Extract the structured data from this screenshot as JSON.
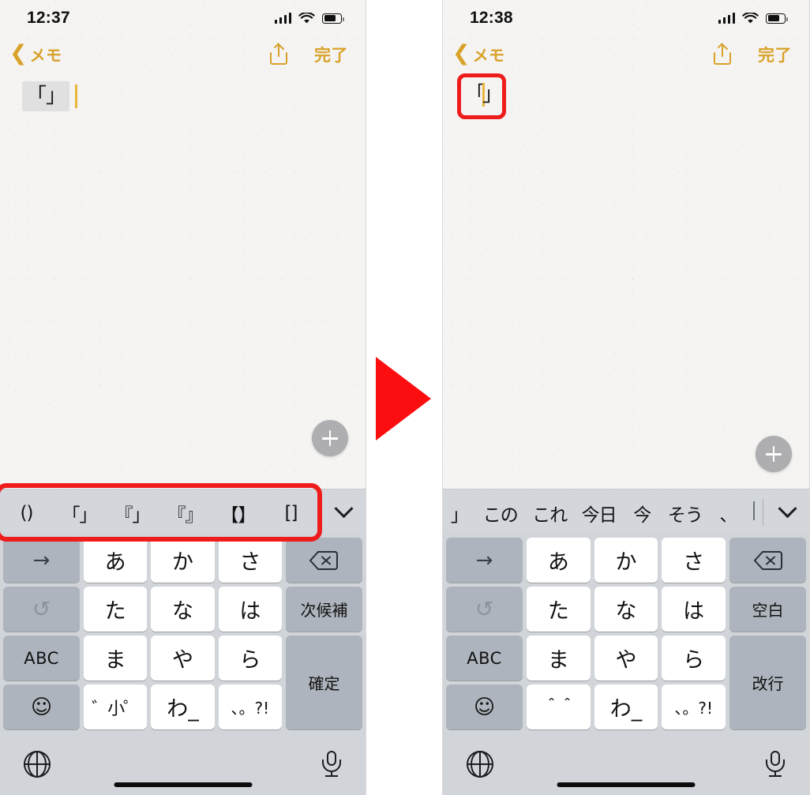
{
  "meta": {
    "accent_gold": "#d8a22a",
    "annotation_red": "#ef1c1c",
    "caret_color": "#e8b63c"
  },
  "panels": [
    {
      "id": "before",
      "status": {
        "time": "12:37",
        "signal_icon": "cellular-bars-icon",
        "wifi_icon": "wifi-icon",
        "battery_icon": "battery-icon"
      },
      "nav": {
        "back_label": "メモ",
        "back_icon": "chevron-left-icon",
        "share_icon": "share-icon",
        "done_label": "完了"
      },
      "note": {
        "text": "「」",
        "marked": true,
        "caret_after": true
      },
      "fab": {
        "icon": "plus-icon"
      },
      "candidates": [
        "()",
        "「」",
        "『」",
        "『』",
        "【】",
        "[]"
      ],
      "candidate_chevron_icon": "chevron-down-icon",
      "keyboard": {
        "row1": [
          "→",
          "あ",
          "か",
          "さ",
          "delete-icon"
        ],
        "row2": [
          "↺",
          "た",
          "な",
          "は",
          "次候補"
        ],
        "row3": [
          "ABC",
          "ま",
          "や",
          "ら",
          "確定"
        ],
        "row4": [
          "☺",
          "゛小゜",
          "わ_",
          "、。?!"
        ],
        "bottom": {
          "globe_icon": "globe-icon",
          "mic_icon": "microphone-icon"
        }
      }
    },
    {
      "id": "after",
      "status": {
        "time": "12:38",
        "signal_icon": "cellular-bars-icon",
        "wifi_icon": "wifi-icon",
        "battery_icon": "battery-icon"
      },
      "nav": {
        "back_label": "メモ",
        "back_icon": "chevron-left-icon",
        "share_icon": "share-icon",
        "done_label": "完了"
      },
      "note": {
        "text_left": "「",
        "text_right": "」",
        "marked": false,
        "caret_between": true
      },
      "fab": {
        "icon": "plus-icon"
      },
      "candidates": [
        "」",
        "この",
        "これ",
        "今日",
        "今",
        "そう",
        "、"
      ],
      "candidate_chevron_icon": "chevron-down-icon",
      "keyboard": {
        "row1": [
          "→",
          "あ",
          "か",
          "さ",
          "delete-icon"
        ],
        "row2": [
          "↺",
          "た",
          "な",
          "は",
          "空白"
        ],
        "row3": [
          "ABC",
          "ま",
          "や",
          "ら",
          "改行"
        ],
        "row4": [
          "☺",
          "＾＾",
          "わ_",
          "、。?!"
        ],
        "bottom": {
          "globe_icon": "globe-icon",
          "mic_icon": "microphone-icon"
        }
      }
    }
  ],
  "annotation": {
    "arrow_icon": "right-triangle-arrow"
  }
}
